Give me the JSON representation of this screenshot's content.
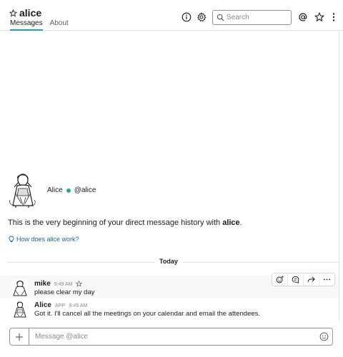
{
  "header": {
    "channel_name": "alice",
    "tabs": [
      {
        "label": "Messages",
        "active": true
      },
      {
        "label": "About",
        "active": false
      }
    ],
    "search_placeholder": "Search",
    "icons": [
      "info-icon",
      "gear-icon",
      "search-icon",
      "mention-icon",
      "star-icon",
      "more-vertical-icon"
    ]
  },
  "intro": {
    "name": "Alice",
    "handle": "@alice",
    "presence_color": "#2bac76",
    "text_prefix": "This is the very beginning of your direct message history with ",
    "text_name": "alice",
    "text_suffix": ".",
    "help_link": "How does alice work?"
  },
  "divider": {
    "label": "Today"
  },
  "messages": [
    {
      "author": "mike",
      "time": "9:49 AM",
      "text": "please clear my day",
      "app_badge": ""
    },
    {
      "author": "Alice",
      "app_badge": "APP",
      "time": "9:49 AM",
      "text": "Got it. I'll cancel all the meetings on your calendar and email the attendees."
    }
  ],
  "message_actions": [
    "add-reaction-icon",
    "reply-thread-icon",
    "share-icon",
    "more-actions-icon"
  ],
  "composer": {
    "placeholder": "Message @alice"
  },
  "colors": {
    "link": "#1264a3",
    "active_tab_underline": "#1d9bd1",
    "hover_row": "#f8f8f8"
  }
}
